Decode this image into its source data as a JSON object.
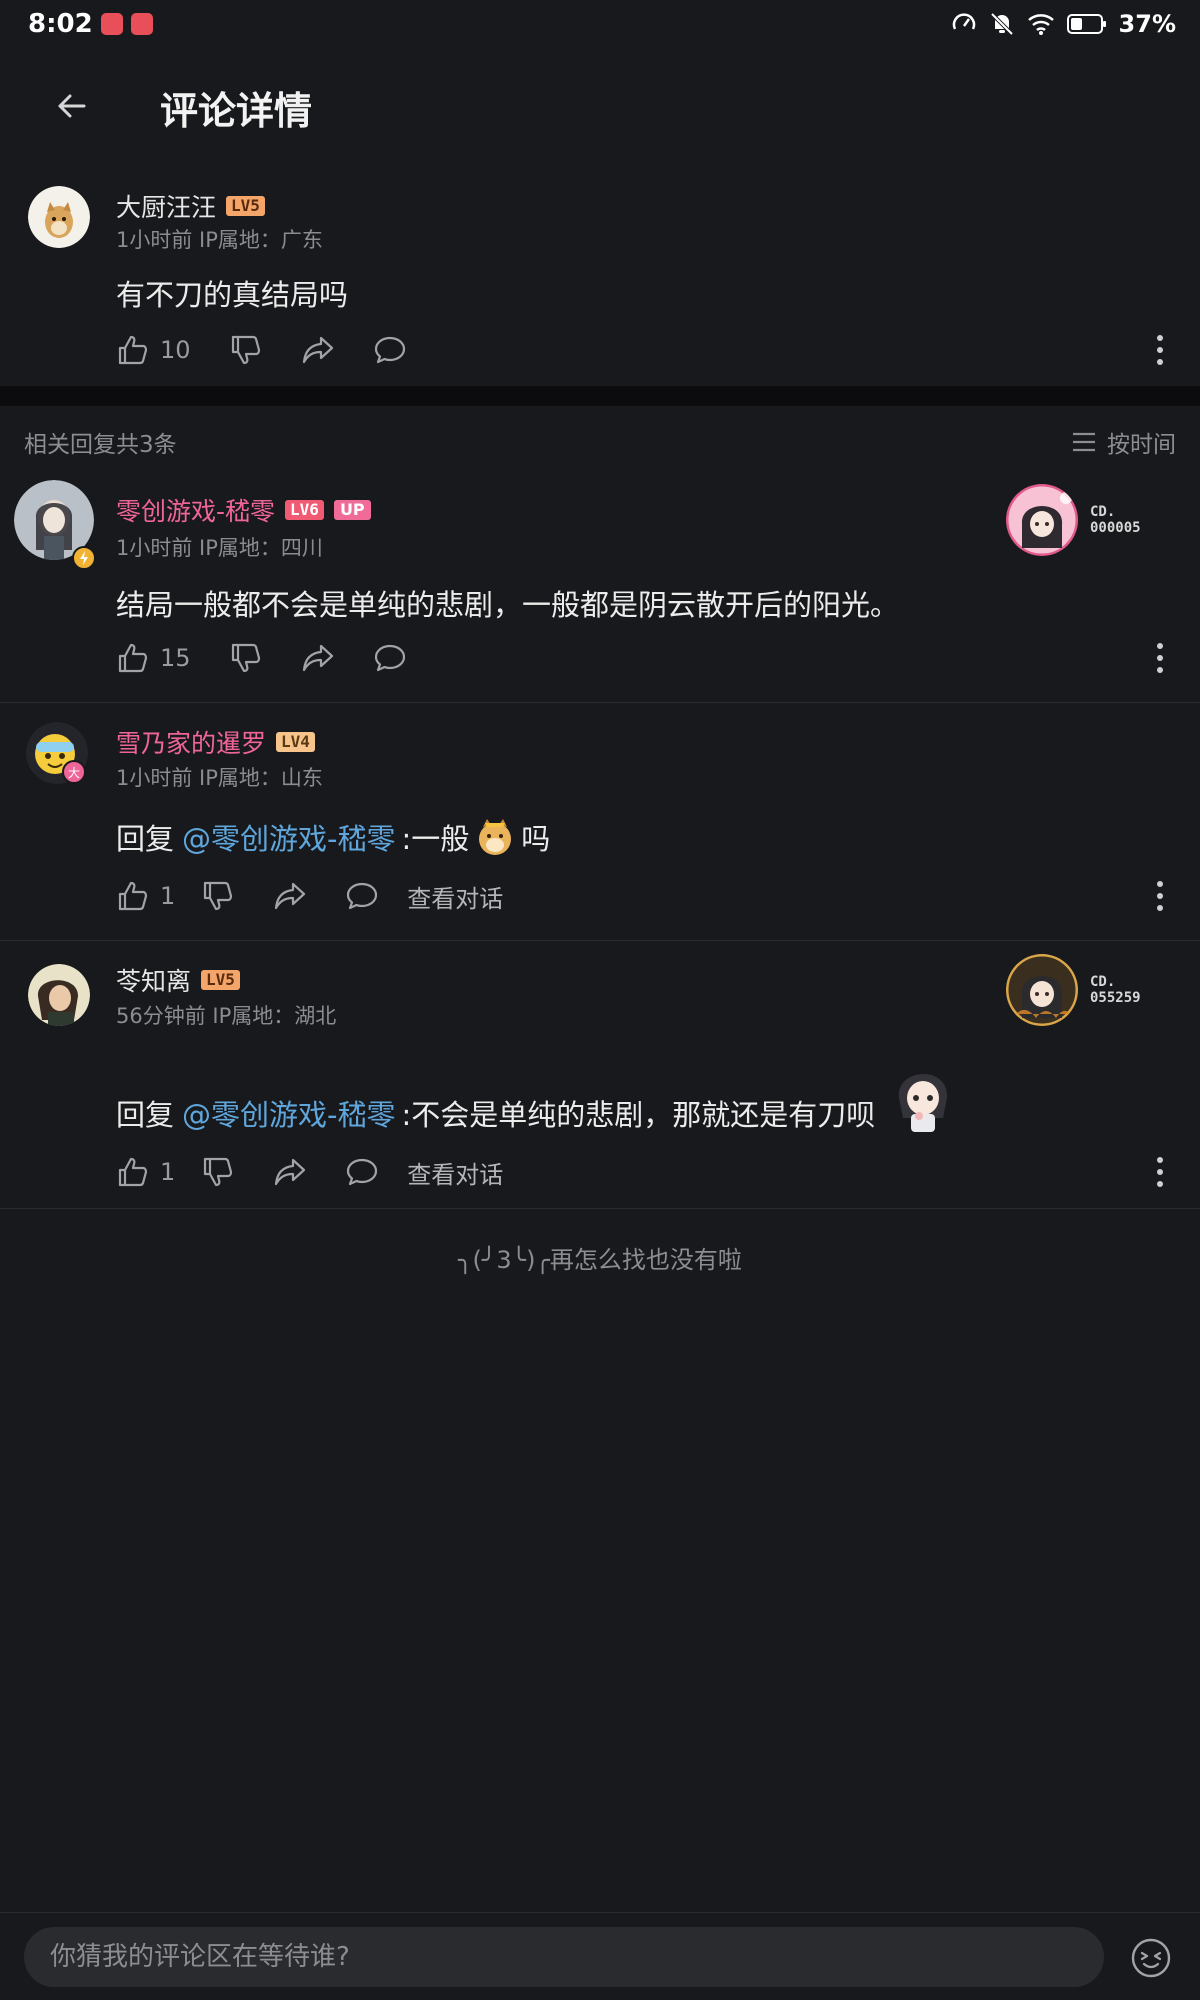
{
  "status_bar": {
    "time": "8:02",
    "battery": "37%",
    "icons": [
      "speed-icon",
      "mute-bell-icon",
      "wifi-icon",
      "battery-icon"
    ]
  },
  "header": {
    "title": "评论详情"
  },
  "root_comment": {
    "username": "大厨汪汪",
    "level": "LV5",
    "meta": "1小时前 IP属地：广东",
    "text": "有不刀的真结局吗",
    "likes": "10"
  },
  "replies_header": {
    "count_text": "相关回复共3条",
    "sort_label": "按时间"
  },
  "replies": [
    {
      "username": "零创游戏-嵇零",
      "level": "LV6",
      "up_tag": "UP",
      "meta": "1小时前 IP属地：四川",
      "text": "结局一般都不会是单纯的悲剧，一般都是阴云散开后的阳光。",
      "likes": "15",
      "badge_code_line1": "CD.",
      "badge_code_line2": "000005"
    },
    {
      "username": "雪乃家的暹罗",
      "level": "LV4",
      "meta": "1小时前 IP属地：山东",
      "reply_prefix": "回复",
      "mention": "@零创游戏-嵇零",
      "text_before": ":一般",
      "text_after": "吗",
      "likes": "1",
      "view_conversation": "查看对话"
    },
    {
      "username": "苓知离",
      "level": "LV5",
      "meta": "56分钟前 IP属地：湖北",
      "reply_prefix": "回复",
      "mention": "@零创游戏-嵇零",
      "text": ":不会是单纯的悲剧，那就还是有刀呗",
      "likes": "1",
      "view_conversation": "查看对话",
      "badge_code_line1": "CD.",
      "badge_code_line2": "055259"
    }
  ],
  "end_note": "╮(╯3╰)╭再怎么找也没有啦",
  "bottom_bar": {
    "input_placeholder": "你猜我的评论区在等待谁?"
  },
  "colors": {
    "background": "#18191c",
    "pink_username": "#f06597",
    "mention": "#5fa6dc",
    "muted": "#8c8d91"
  }
}
